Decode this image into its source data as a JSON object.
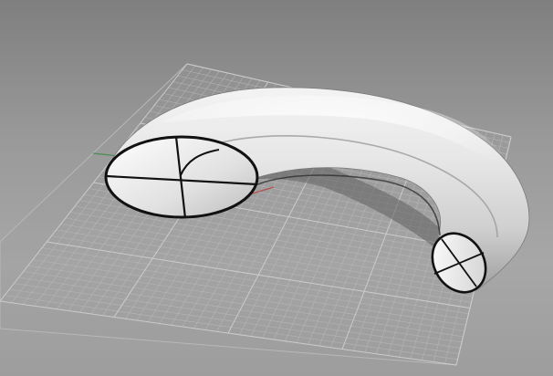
{
  "viewport": {
    "kind": "perspective-3d-viewport",
    "background_color": "#8f8f8f",
    "grid_minor_color": "#b9b9b9",
    "grid_major_color": "#d0d0d0",
    "x_axis_color": "#b35050",
    "y_axis_color": "#4a8f52"
  },
  "model": {
    "object": "swept-tube",
    "shape": "curved tube with tapering circular cross-section",
    "surface_color": "#e7e7e7",
    "edge_color": "#111111",
    "end_caps": [
      "large-profile-circle",
      "small-profile-circle"
    ]
  }
}
